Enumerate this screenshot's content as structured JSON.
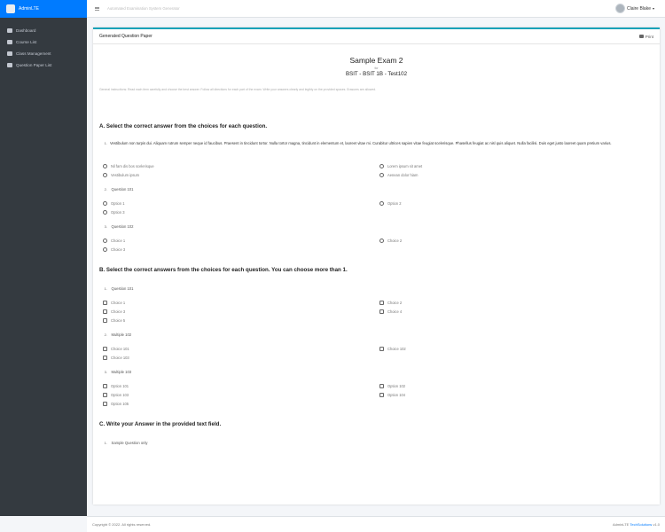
{
  "brand": {
    "name": "AdminLTE"
  },
  "sidebar": {
    "items": [
      {
        "label": "Dashboard",
        "icon": "dashboard-icon"
      },
      {
        "label": "Course List",
        "icon": "list-icon"
      },
      {
        "label": "Class Management",
        "icon": "class-icon"
      },
      {
        "label": "Question Paper List",
        "icon": "paper-icon"
      }
    ]
  },
  "topbar": {
    "title": "Automated Examination System Generator",
    "user_name": "Claire Blake"
  },
  "card": {
    "title": "Generated Question Paper",
    "print_label": "Print"
  },
  "paper": {
    "title": "Sample Exam 2",
    "for_label": "for",
    "class_label": "BSIT - BSIT 1B - Test102",
    "instructions": "General instructions: Read each item carefully and choose the best answer. Follow all directions for each part of the exam. Write your answers clearly and legibly on the provided spaces. Erasures are allowed."
  },
  "sections": {
    "a": {
      "title": "A. Select the correct answer from the choices for each question.",
      "questions": [
        {
          "num": "1.",
          "text": "Vestibulum non turpis dui. Aliquam rutrum semper neque id faucibus. Praesent in tincidunt tortor. Nulla tortor magna, tincidunt in elementum et, laoreet vitae mi. Curabitur ultrices sapien vitae feugiat scelerisque. Phasellus feugiat ac nisl quis aliquet. Nulla facilisi. Duis eget justo laoreet quam pretium varius.",
          "options": [
            "Nil fam dis bos scelerisque",
            "Lorem ipsum sit amet",
            "Vestibulum ipsum",
            "Aenean dolor hiam"
          ]
        },
        {
          "num": "2.",
          "text": "Question 101",
          "options": [
            "Option 1",
            "Option 2",
            "Option 3"
          ]
        },
        {
          "num": "3.",
          "text": "Question 102",
          "options": [
            "Choice 1",
            "Choice 2",
            "Choice 3"
          ]
        }
      ]
    },
    "b": {
      "title": "B. Select the correct answers from the choices for each question. You can choose more than 1.",
      "questions": [
        {
          "num": "1.",
          "text": "Question 101",
          "options": [
            "Choice 1",
            "Choice 2",
            "Choice 3",
            "Choice 4",
            "Choice 5"
          ]
        },
        {
          "num": "2.",
          "text": "Multiple 102",
          "options": [
            "Choice 101",
            "Choice 102",
            "Choice 103"
          ]
        },
        {
          "num": "3.",
          "text": "Multiple 103",
          "options": [
            "Option 101",
            "Option 102",
            "Option 103",
            "Option 104",
            "Option 105"
          ]
        }
      ]
    },
    "c": {
      "title": "C. Write your Answer in the provided text field.",
      "questions": [
        {
          "num": "1.",
          "text": "Sample Question only"
        }
      ]
    }
  },
  "footer": {
    "copyright": "Copyright © 2022. All rights reserved.",
    "right_prefix": "AdminLTE",
    "right_accent": "TechSolutions",
    "version": "v1.0"
  }
}
